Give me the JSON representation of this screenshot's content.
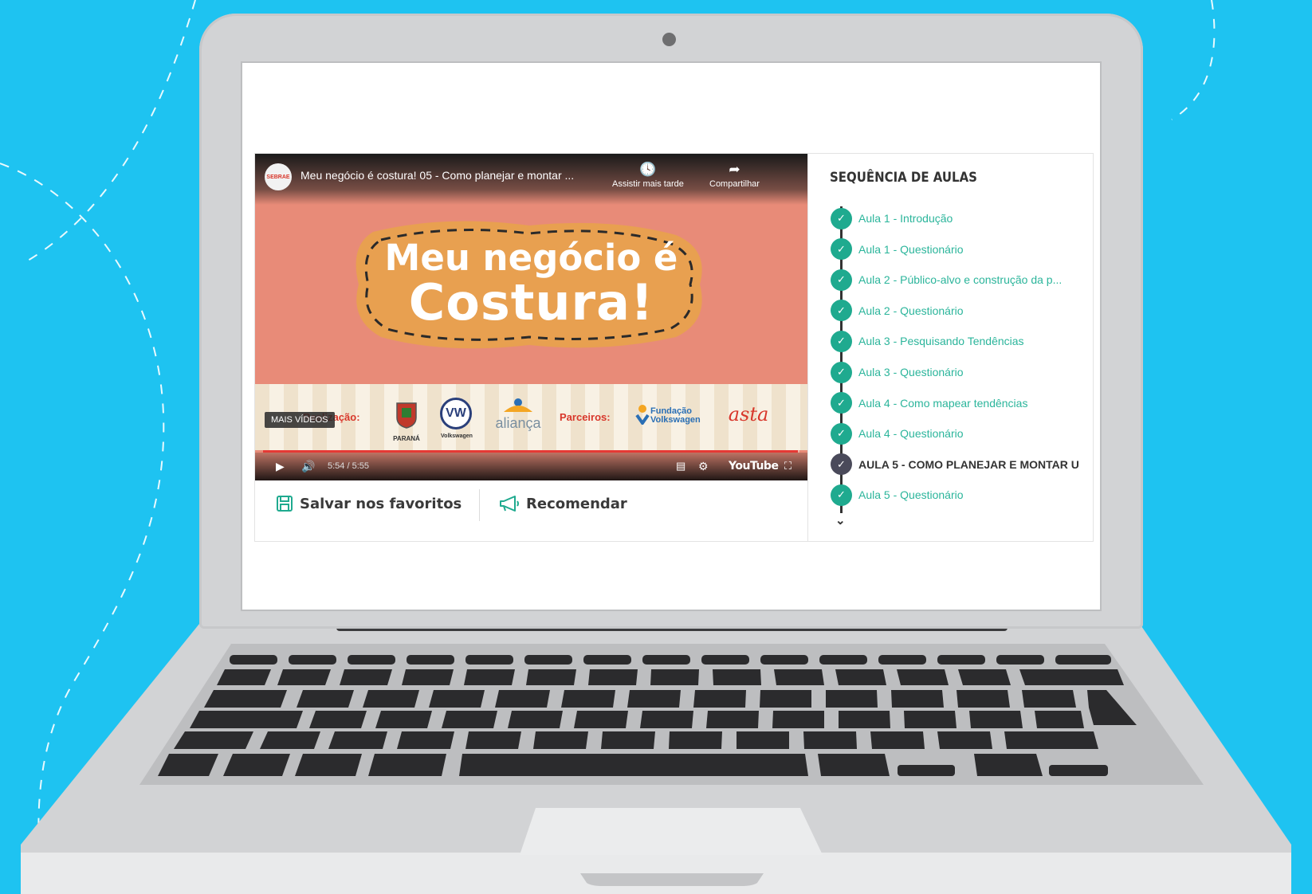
{
  "video": {
    "channel_logo_text": "SEBRAE",
    "title": "Meu negócio é costura! 05 - Como planejar e montar ...",
    "watch_later_label": "Assistir mais tarde",
    "share_label": "Compartilhar",
    "banner_line1": "Meu negócio é",
    "banner_line2": "Costura!",
    "realizacao_label": "Realização:",
    "parceiros_label": "Parceiros:",
    "mais_videos_label": "MAIS VÍDEOS",
    "sponsor_logos": [
      "PARANÁ",
      "Volkswagen",
      "aliança",
      "Fundação Volkswagen",
      "asta"
    ],
    "time": "5:54 / 5:55",
    "progress": 0.997,
    "youtube_label": "YouTube"
  },
  "actions": {
    "save_label": "Salvar nos favoritos",
    "recommend_label": "Recomendar"
  },
  "sidebar": {
    "title": "SEQUÊNCIA DE AULAS",
    "lessons": [
      {
        "label": "Aula 1 - Introdução",
        "status": "done"
      },
      {
        "label": "Aula 1 - Questionário",
        "status": "done"
      },
      {
        "label": "Aula 2 - Público-alvo e construção da p...",
        "status": "done"
      },
      {
        "label": "Aula 2 - Questionário",
        "status": "done"
      },
      {
        "label": "Aula 3 - Pesquisando Tendências",
        "status": "done"
      },
      {
        "label": "Aula 3 - Questionário",
        "status": "done"
      },
      {
        "label": "Aula 4 - Como mapear tendências",
        "status": "done"
      },
      {
        "label": "Aula 4 - Questionário",
        "status": "done"
      },
      {
        "label": "AULA 5 - COMO PLANEJAR E MONTAR U",
        "status": "current"
      },
      {
        "label": "Aula 5 - Questionário",
        "status": "done"
      }
    ]
  },
  "colors": {
    "background": "#1ec3f1",
    "accent_teal": "#1faa8f",
    "video_bg": "#e88b78",
    "banner_tag": "#e8a050"
  }
}
